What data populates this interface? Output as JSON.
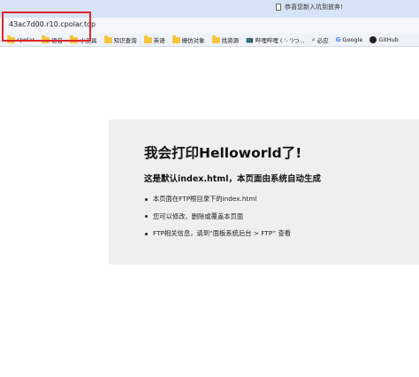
{
  "browser": {
    "notice_text": "恭喜您新入坑到放弃!",
    "address_url": "43ac7d00.r10.cpolar.top"
  },
  "bookmarks": [
    {
      "label": "cpolar",
      "icon": "folder-icon"
    },
    {
      "label": "语音",
      "icon": "folder-icon"
    },
    {
      "label": "小工具",
      "icon": "folder-icon"
    },
    {
      "label": "知识查询",
      "icon": "folder-icon"
    },
    {
      "label": "英语",
      "icon": "folder-icon"
    },
    {
      "label": "栅仿对象",
      "icon": "folder-icon"
    },
    {
      "label": "找资源",
      "icon": "folder-icon"
    },
    {
      "label": "哔哩哔哩 ( '- ')つ...",
      "icon": "bilibili-tv-icon"
    },
    {
      "label": "必应",
      "icon": "search-icon"
    },
    {
      "label": "Google",
      "icon": "google-icon"
    },
    {
      "label": "GitHub",
      "icon": "github-icon"
    }
  ],
  "content": {
    "heading": "我会打印Helloworld了!",
    "subheading": "这是默认index.html，本页面由系统自动生成",
    "items": [
      "本页面在FTP根目录下的index.html",
      "您可以修改、删除或覆盖本页面",
      "FTP相关信息，请到“面板系统后台 > FTP” 查看"
    ]
  }
}
